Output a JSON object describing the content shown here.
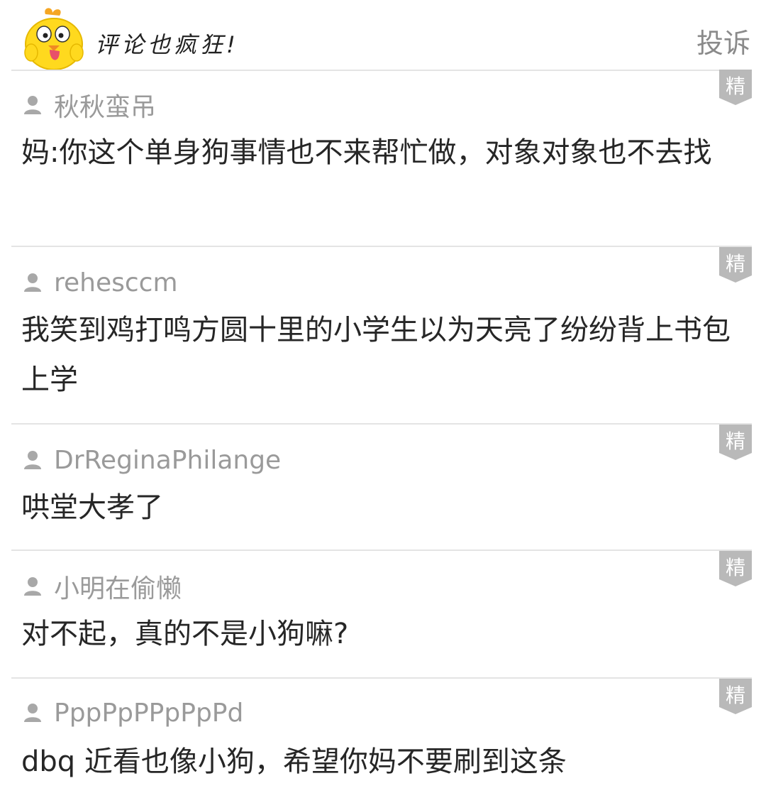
{
  "header": {
    "title": "评论也疯狂!",
    "report_label": "投诉"
  },
  "badge_label": "精",
  "comments": [
    {
      "username": "秋秋蛮吊",
      "text": "妈:你这个单身狗事情也不来帮忙做，对象对象也不去找"
    },
    {
      "username": "rehesccm",
      "text": "我笑到鸡打鸣方圆十里的小学生以为天亮了纷纷背上书包上学"
    },
    {
      "username": "DrReginaPhilange",
      "text": "哄堂大孝了"
    },
    {
      "username": "小明在偷懒",
      "text": "对不起，真的不是小狗嘛?"
    },
    {
      "username": "PppPpPPpPpPd",
      "text": "dbq 近看也像小狗，希望你妈不要刷到这条"
    }
  ],
  "icons": {
    "mascot": "yellow-chick-mascot-icon",
    "user": "user-icon",
    "badge": "featured-badge-icon"
  },
  "colors": {
    "divider": "#e4e4e4",
    "username": "#9a9a9a",
    "badge": "#b9b9b9",
    "mascot": "#ffd91e"
  }
}
